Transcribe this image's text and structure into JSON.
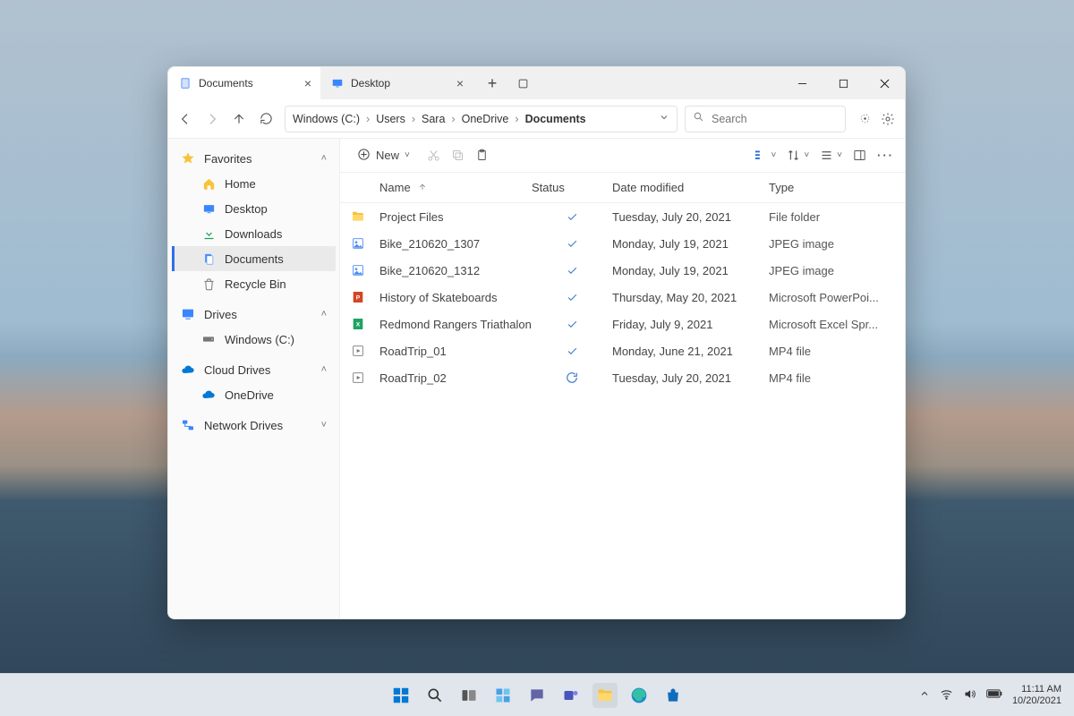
{
  "tabs": [
    {
      "label": "Documents",
      "active": true
    },
    {
      "label": "Desktop",
      "active": false
    }
  ],
  "breadcrumbs": [
    "Windows (C:)",
    "Users",
    "Sara",
    "OneDrive",
    "Documents"
  ],
  "search": {
    "placeholder": "Search"
  },
  "toolbar": {
    "new_label": "New"
  },
  "sidebar": {
    "favorites_label": "Favorites",
    "favorites": [
      {
        "label": "Home",
        "icon": "home"
      },
      {
        "label": "Desktop",
        "icon": "desktop"
      },
      {
        "label": "Downloads",
        "icon": "downloads"
      },
      {
        "label": "Documents",
        "icon": "documents",
        "selected": true
      },
      {
        "label": "Recycle Bin",
        "icon": "recycle"
      }
    ],
    "drives_label": "Drives",
    "drives": [
      {
        "label": "Windows (C:)",
        "icon": "drive"
      }
    ],
    "cloud_label": "Cloud Drives",
    "cloud": [
      {
        "label": "OneDrive",
        "icon": "onedrive"
      }
    ],
    "network_label": "Network Drives"
  },
  "columns": {
    "name": "Name",
    "status": "Status",
    "date": "Date modified",
    "type": "Type"
  },
  "files": [
    {
      "name": "Project Files",
      "icon": "folder",
      "status": "check",
      "date": "Tuesday, July 20, 2021",
      "type": "File folder"
    },
    {
      "name": "Bike_210620_1307",
      "icon": "image",
      "status": "check",
      "date": "Monday, July 19, 2021",
      "type": "JPEG image"
    },
    {
      "name": "Bike_210620_1312",
      "icon": "image",
      "status": "check",
      "date": "Monday, July 19, 2021",
      "type": "JPEG image"
    },
    {
      "name": "History of Skateboards",
      "icon": "ppt",
      "status": "check",
      "date": "Thursday, May 20, 2021",
      "type": "Microsoft PowerPoi..."
    },
    {
      "name": "Redmond Rangers Triathalon",
      "icon": "xls",
      "status": "check",
      "date": "Friday, July 9, 2021",
      "type": "Microsoft Excel Spr..."
    },
    {
      "name": "RoadTrip_01",
      "icon": "video",
      "status": "check",
      "date": "Monday, June 21, 2021",
      "type": "MP4 file"
    },
    {
      "name": "RoadTrip_02",
      "icon": "video",
      "status": "sync",
      "date": "Tuesday, July 20, 2021",
      "type": "MP4 file"
    }
  ],
  "system_tray": {
    "time": "11:11 AM",
    "date": "10/20/2021"
  }
}
